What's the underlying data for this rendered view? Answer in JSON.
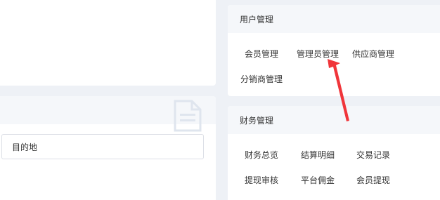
{
  "user_panel": {
    "title": "用户管理",
    "links": [
      "会员管理",
      "管理员管理",
      "供应商管理",
      "分销商管理"
    ]
  },
  "finance_panel": {
    "title": "财务管理",
    "links": [
      "财务总览",
      "结算明细",
      "交易记录",
      "提现审核",
      "平台佣金",
      "会员提现"
    ]
  },
  "destination": {
    "value": "目的地"
  },
  "icons": {
    "document": "document-icon",
    "annotation": "red-arrow"
  },
  "colors": {
    "background": "#eef1f6",
    "card": "#ffffff",
    "card_header": "#f5f7fa",
    "arrow": "#f0353a"
  }
}
